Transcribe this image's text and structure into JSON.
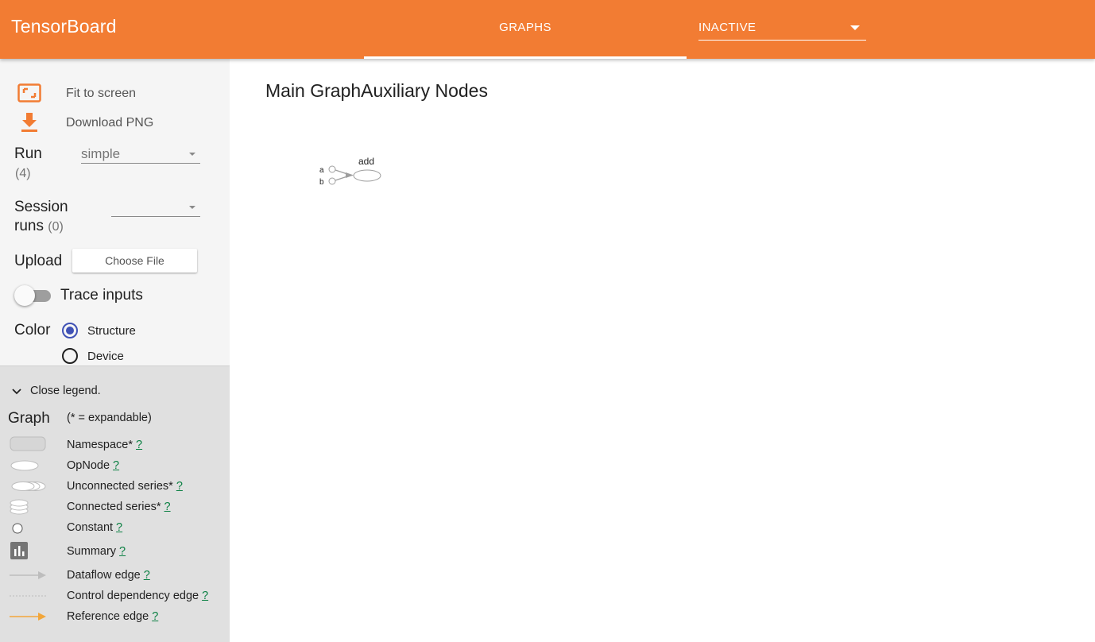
{
  "header": {
    "brand": "TensorBoard",
    "active_tab": "GRAPHS",
    "dashboard_select": "INACTIVE",
    "colors": {
      "header_bg": "#f27c33",
      "accent": "#3f51b5",
      "link": "#0b8043"
    }
  },
  "sidebar": {
    "fit_to_screen": "Fit to screen",
    "download_png": "Download PNG",
    "run": {
      "label": "Run",
      "count": "(4)",
      "value": "simple"
    },
    "session_runs": {
      "label_line1": "Session",
      "label_line2": "runs",
      "count": "(0)",
      "value": ""
    },
    "upload": {
      "label": "Upload",
      "button": "Choose File"
    },
    "trace_inputs": {
      "label": "Trace inputs",
      "enabled": false
    },
    "color": {
      "label": "Color",
      "options": [
        {
          "label": "Structure",
          "selected": true
        },
        {
          "label": "Device",
          "selected": false
        }
      ]
    }
  },
  "legend": {
    "toggle": "Close legend.",
    "title": "Graph",
    "subtitle": "(* = expandable)",
    "help": "?",
    "items": [
      {
        "icon": "namespace-icon",
        "label": "Namespace*"
      },
      {
        "icon": "opnode-icon",
        "label": "OpNode"
      },
      {
        "icon": "unconnected-series-icon",
        "label": "Unconnected series*"
      },
      {
        "icon": "connected-series-icon",
        "label": "Connected series*"
      },
      {
        "icon": "constant-icon",
        "label": "Constant"
      },
      {
        "icon": "summary-icon",
        "label": "Summary"
      },
      {
        "icon": "dataflow-edge-icon",
        "label": "Dataflow edge"
      },
      {
        "icon": "control-dependency-edge-icon",
        "label": "Control dependency edge"
      },
      {
        "icon": "reference-edge-icon",
        "label": "Reference edge"
      }
    ]
  },
  "main": {
    "title": "Main GraphAuxiliary Nodes",
    "graph": {
      "inputs": [
        "a",
        "b"
      ],
      "op": "add"
    }
  }
}
